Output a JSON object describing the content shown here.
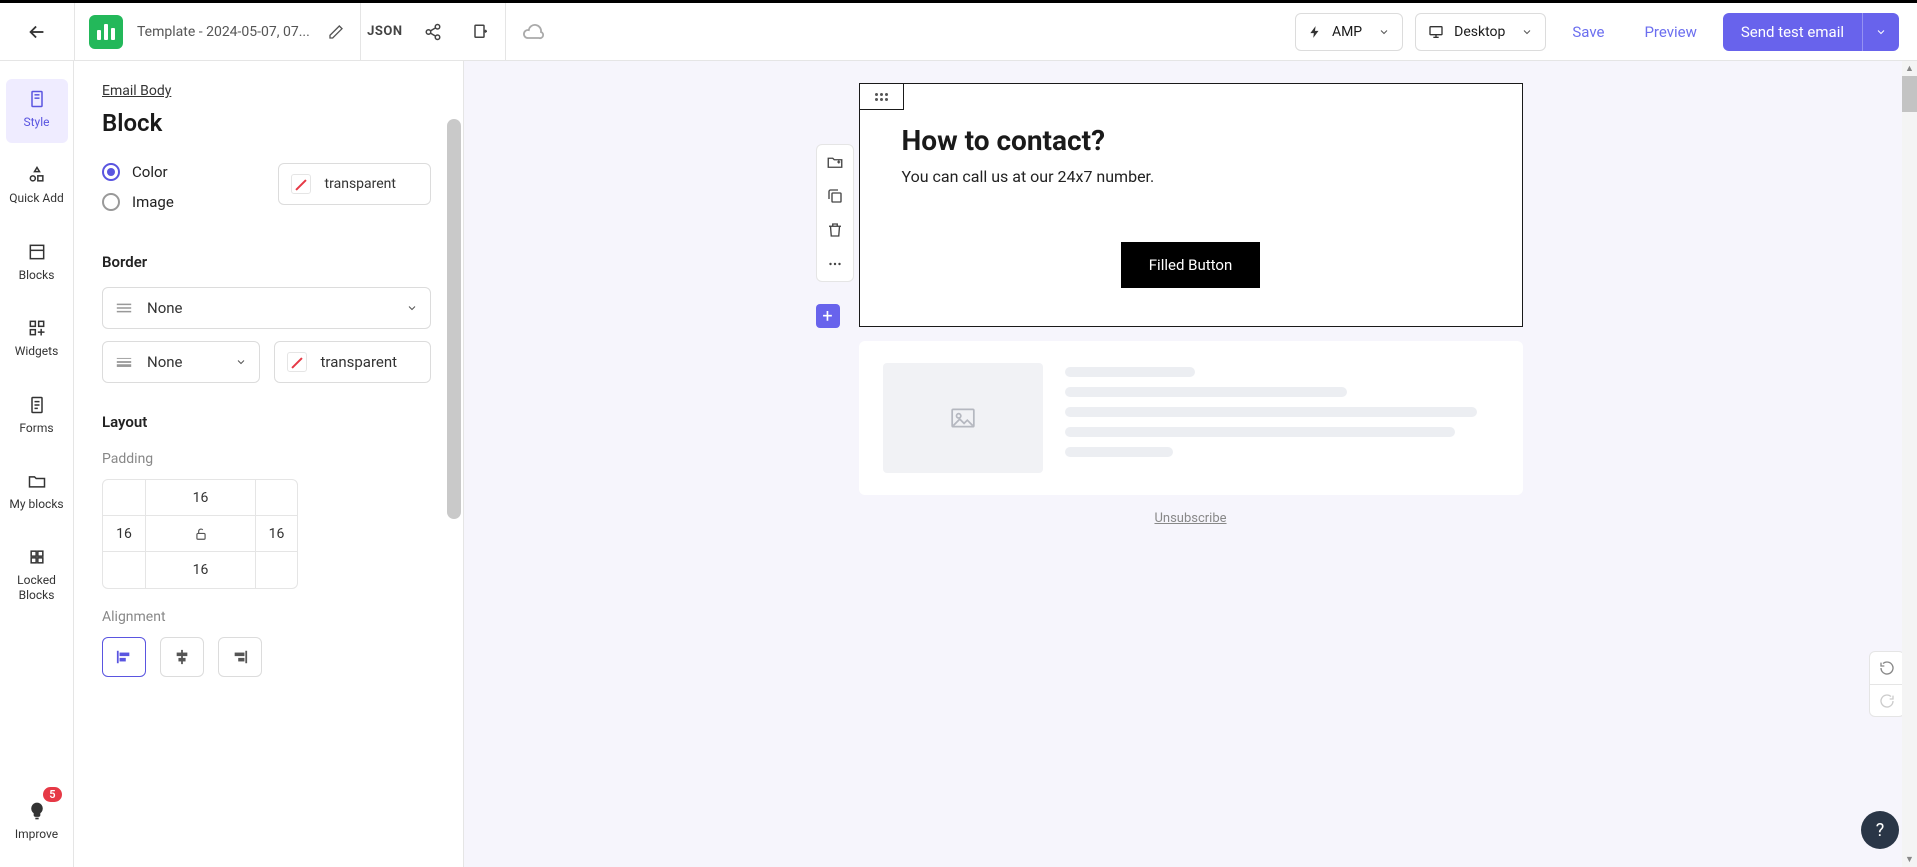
{
  "header": {
    "template_name": "Template - 2024-05-07, 07...",
    "json_label": "JSON",
    "amp_label": "AMP",
    "viewport_label": "Desktop",
    "save_label": "Save",
    "preview_label": "Preview",
    "send_label": "Send test email"
  },
  "sidebar": {
    "items": [
      {
        "label": "Style"
      },
      {
        "label": "Quick Add"
      },
      {
        "label": "Blocks"
      },
      {
        "label": "Widgets"
      },
      {
        "label": "Forms"
      },
      {
        "label": "My blocks"
      },
      {
        "label": "Locked Blocks"
      }
    ],
    "improve_label": "Improve",
    "improve_badge": "5"
  },
  "panel": {
    "breadcrumb": "Email Body",
    "title": "Block",
    "bg": {
      "color_label": "Color",
      "image_label": "Image",
      "swatch_label": "transparent"
    },
    "border": {
      "section": "Border",
      "style": "None",
      "width": "None",
      "color": "transparent"
    },
    "layout": {
      "section": "Layout",
      "padding_label": "Padding",
      "padding": {
        "top": "16",
        "right": "16",
        "bottom": "16",
        "left": "16"
      },
      "alignment_label": "Alignment"
    }
  },
  "canvas": {
    "heading": "How to contact?",
    "paragraph": "You can call us at our 24x7 number.",
    "button_label": "Filled Button",
    "unsubscribe": "Unsubscribe"
  },
  "help_glyph": "?"
}
